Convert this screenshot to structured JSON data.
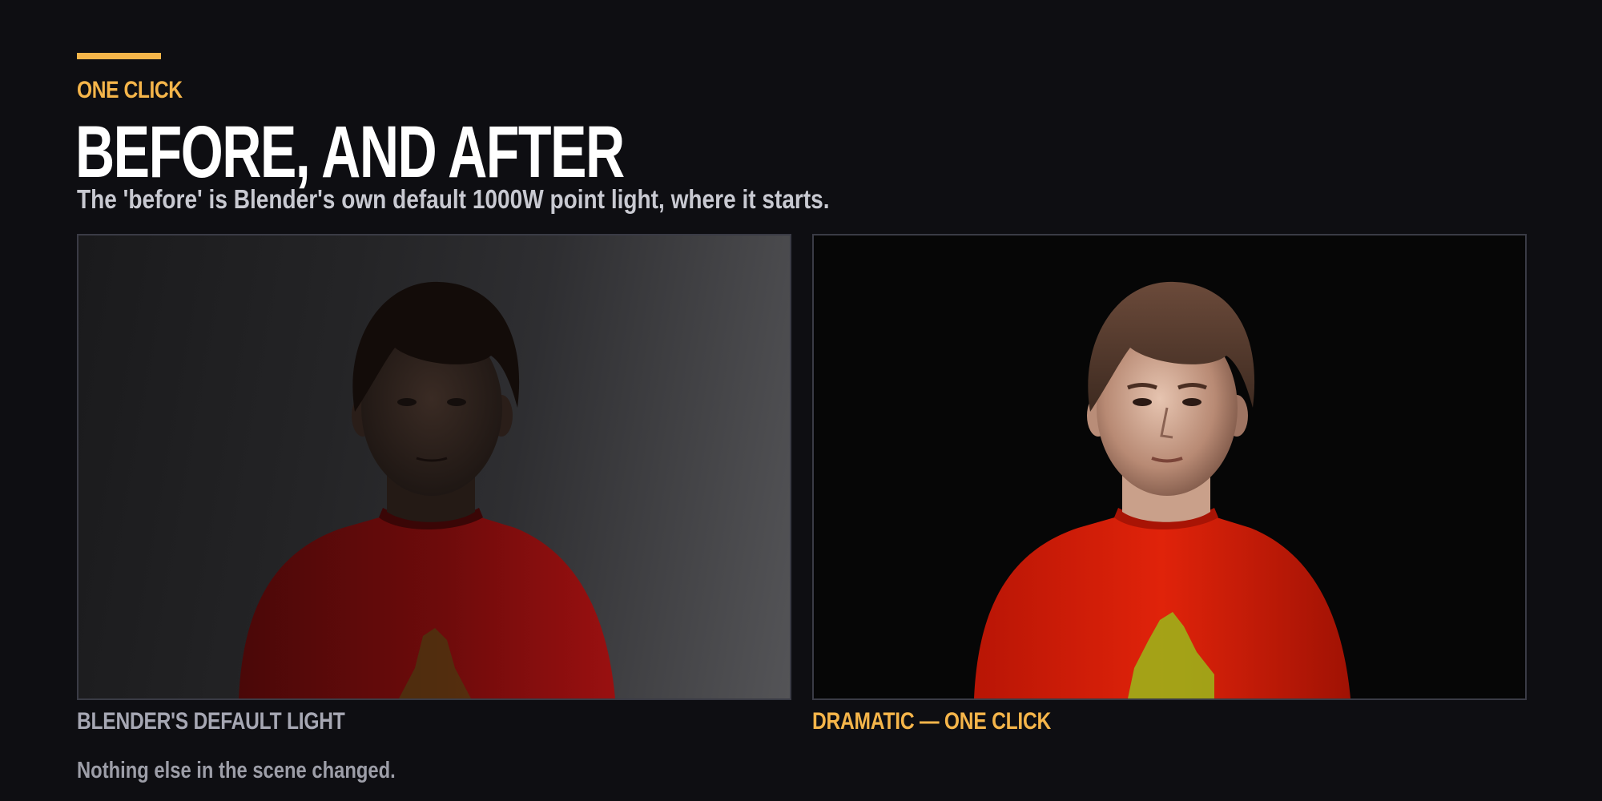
{
  "header": {
    "eyebrow": "ONE CLICK",
    "title": "BEFORE, AND AFTER",
    "subtitle": "The 'before' is Blender's own default 1000W point light, where it starts."
  },
  "comparison": {
    "before": {
      "caption": "BLENDER'S DEFAULT LIGHT"
    },
    "after": {
      "caption": "DRAMATIC — ONE CLICK"
    }
  },
  "footer": {
    "note": "Nothing else in the scene changed."
  },
  "colors": {
    "background": "#0e0e12",
    "accent": "#f5b54a",
    "title": "#ffffff",
    "subtitle": "#c8c9d1",
    "caption_muted": "#a6a7b3",
    "panel_border": "#3a3b45"
  }
}
